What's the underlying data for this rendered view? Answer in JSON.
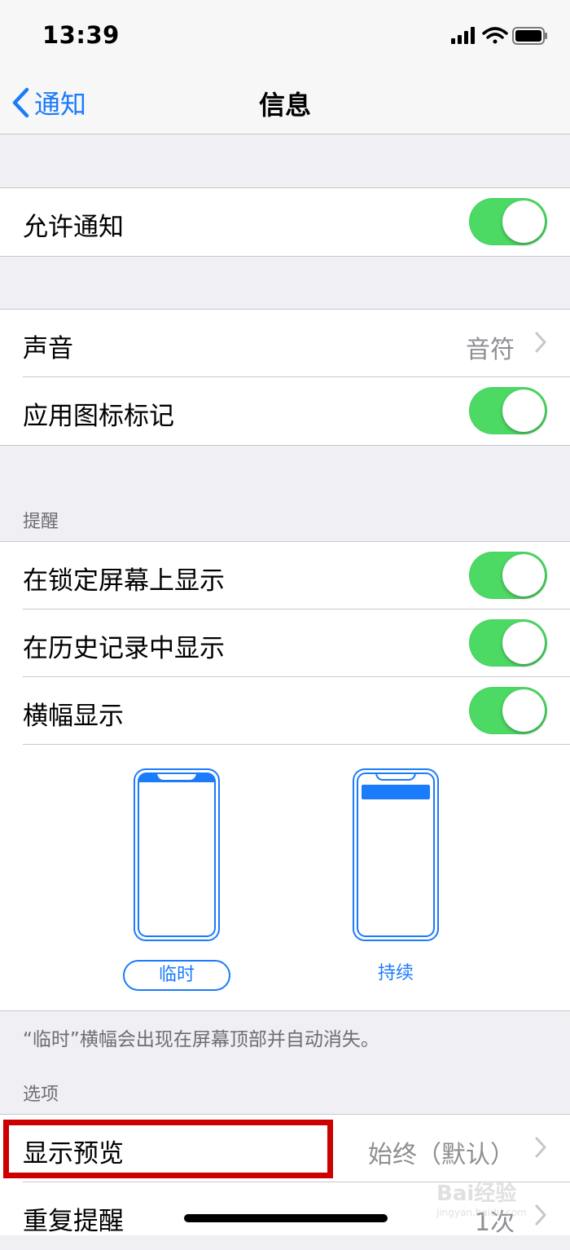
{
  "status_bar": {
    "time": "13:39",
    "icons": [
      "signal-icon",
      "wifi-icon",
      "battery-icon"
    ]
  },
  "nav": {
    "back_label": "通知",
    "title": "信息"
  },
  "allow": {
    "label": "允许通知",
    "on": true
  },
  "sound": {
    "label": "声音",
    "value": "音符"
  },
  "badge": {
    "label": "应用图标标记",
    "on": true
  },
  "alerts": {
    "header": "提醒",
    "lock_screen": {
      "label": "在锁定屏幕上显示",
      "on": true
    },
    "history": {
      "label": "在历史记录中显示",
      "on": true
    },
    "banners": {
      "label": "横幅显示",
      "on": true
    },
    "banner_styles": {
      "temporary": "临时",
      "persistent": "持续",
      "selected": "临时"
    },
    "footer": "“临时”横幅会出现在屏幕顶部并自动消失。"
  },
  "options": {
    "header": "选项",
    "show_previews": {
      "label": "显示预览",
      "value": "始终（默认）"
    },
    "repeat_alerts": {
      "label": "重复提醒",
      "value": "1次"
    }
  },
  "watermark": {
    "text": "Bai经验",
    "url": "jingyan.baidu.com"
  },
  "colors": {
    "accent": "#1a7bfb",
    "toggle_on": "#4cd964",
    "highlight": "#cc0000"
  }
}
